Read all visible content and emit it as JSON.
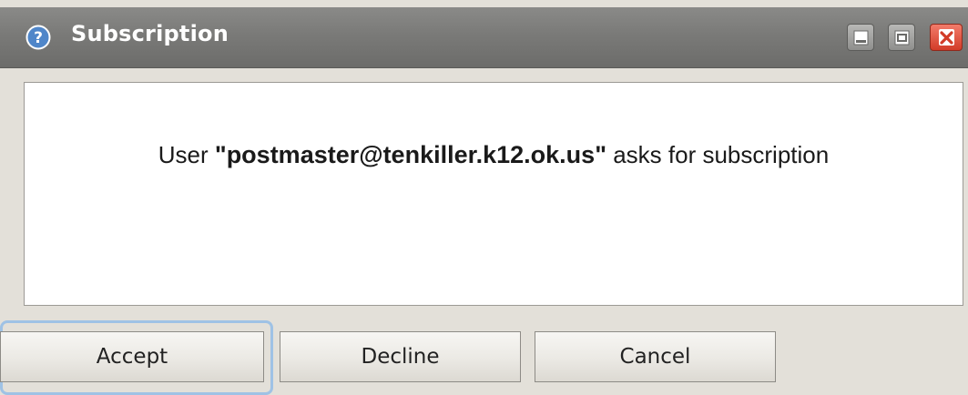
{
  "window": {
    "title": "Subscription",
    "title_icon": "help-icon",
    "controls": {
      "minimize_icon": "minimize-icon",
      "maximize_icon": "maximize-icon",
      "close_icon": "close-icon"
    }
  },
  "message": {
    "prefix": "User ",
    "user": "\"postmaster@tenkiller.k12.ok.us\"",
    "suffix": " asks for subscription"
  },
  "buttons": {
    "accept": "Accept",
    "decline": "Decline",
    "cancel": "Cancel"
  },
  "colors": {
    "titlebar": "#7a7a78",
    "close_button": "#d23c28",
    "focus_ring": "#9fc2e5"
  }
}
